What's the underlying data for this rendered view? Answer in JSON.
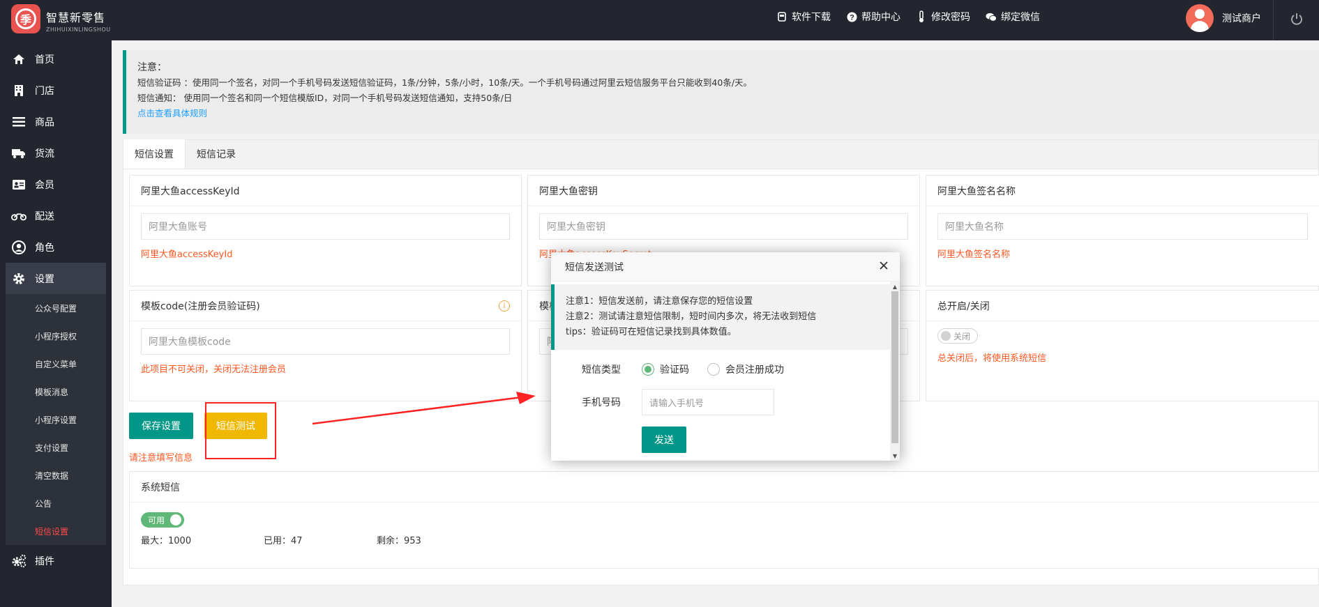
{
  "header": {
    "brand_title": "智慧新零售",
    "brand_sub": "ZHIHUIXINLINGSHOU",
    "links": [
      "软件下载",
      "帮助中心",
      "修改密码",
      "绑定微信"
    ],
    "user_name": "测试商户"
  },
  "sidebar": {
    "items": [
      "首页",
      "门店",
      "商品",
      "货流",
      "会员",
      "配送",
      "角色",
      "设置"
    ],
    "sub_items": [
      "公众号配置",
      "小程序授权",
      "自定义菜单",
      "模板消息",
      "小程序设置",
      "支付设置",
      "清空数据",
      "公告",
      "短信设置"
    ],
    "last_item": "插件"
  },
  "notice": {
    "title": "注意：",
    "line1": "短信验证码 ：使用同一个签名，对同一个手机号码发送短信验证码，1条/分钟，5条/小时，10条/天。一个手机号码通过阿里云短信服务平台只能收到40条/天。",
    "line2": "短信通知： 使用同一个签名和同一个短信模版ID，对同一个手机号码发送短信通知，支持50条/日",
    "link": "点击查看具体规则"
  },
  "tabs": [
    "短信设置",
    "短信记录"
  ],
  "cards": {
    "key_id": {
      "title": "阿里大鱼accessKeyId",
      "placeholder": "阿里大鱼账号",
      "hint": "阿里大鱼accessKeyId"
    },
    "secret": {
      "title": "阿里大鱼密钥",
      "placeholder": "阿里大鱼密钥",
      "hint": "阿里大鱼accessKeySecret"
    },
    "sign": {
      "title": "阿里大鱼签名名称",
      "placeholder": "阿里大鱼名称",
      "hint": "阿里大鱼签名名称"
    },
    "template": {
      "title": "模板code(注册会员验证码)",
      "placeholder": "阿里大鱼模板code",
      "hint": "此项目不可关闭，关闭无法注册会员"
    },
    "template2": {
      "title": "模板",
      "placeholder": "阿"
    },
    "master": {
      "title": "总开启/关闭",
      "toggle": "关闭",
      "hint": "总关闭后，将使用系统短信"
    }
  },
  "buttons": {
    "save": "保存设置",
    "test": "短信测试",
    "warning": "请注意填写信息"
  },
  "system": {
    "title": "系统短信",
    "toggle": "可用",
    "max": "最大：1000",
    "used": "已用：47",
    "remain": "剩余：953"
  },
  "modal": {
    "title": "短信发送测试",
    "note1": "注意1：短信发送前，请注意保存您的短信设置",
    "note2": "注意2：测试请注意短信限制，短时间内多次，将无法收到短信",
    "tips": "tips：验证码可在短信记录找到具体数值。",
    "type_label": "短信类型",
    "options": [
      "验证码",
      "会员注册成功"
    ],
    "phone_label": "手机号码",
    "phone_placeholder": "请输入手机号",
    "send": "发送"
  },
  "colors": {
    "accent": "#009688",
    "warning": "#ff5722",
    "test_button": "#f0b800",
    "annotation": "#ff2323"
  }
}
